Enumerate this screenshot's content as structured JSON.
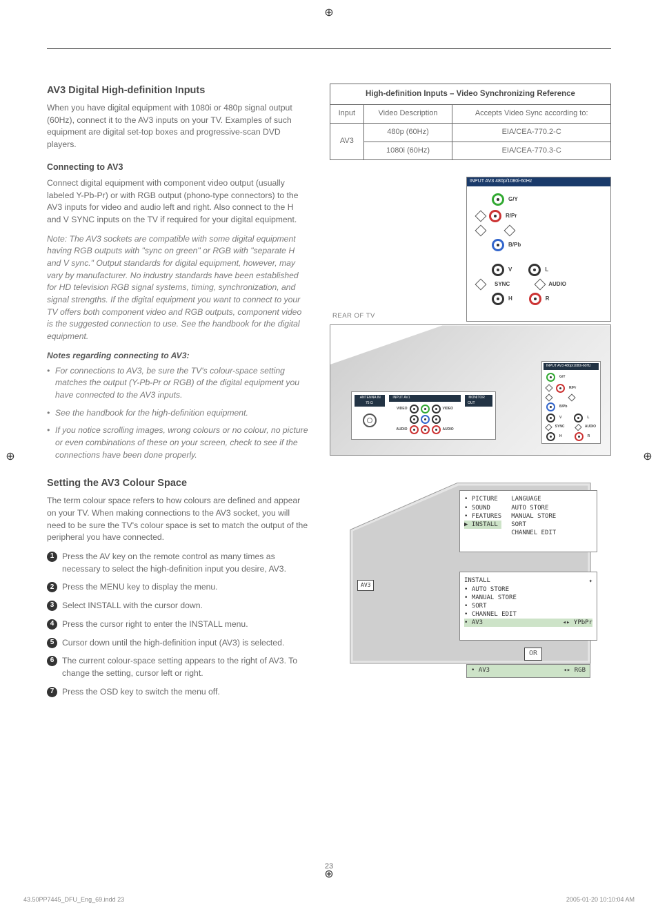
{
  "page_number": "23",
  "footer_left": "43.50PP7445_DFU_Eng_69.indd   23",
  "footer_right": "2005-01-20   10:10:04 AM",
  "section1": {
    "title": "AV3 Digital High-definition Inputs",
    "intro": "When you have digital equipment with 1080i or 480p signal output (60Hz), connect it to the AV3 inputs on your TV. Examples of such equipment are digital set-top boxes and progressive-scan DVD players.",
    "sub1": "Connecting to AV3",
    "p1": "Connect digital equipment with component video output (usually labeled Y-Pb-Pr) or with RGB output (phono-type connectors) to the AV3 inputs for video and audio left and right. Also connect to the H and V SYNC inputs on the TV if required for your digital equipment.",
    "note": "Note: The AV3 sockets are compatible with some digital equipment having RGB outputs with \"sync on green\" or RGB with \"separate H and V sync.\" Output standards for digital equipment, however, may vary by manufacturer. No industry standards have been established for HD television RGB signal systems, timing, synchronization, and signal strengths. If the digital equipment you want to connect to your TV offers both component video and RGB outputs, component video is the suggested connection to use. See the handbook for the digital equipment.",
    "notes_hdr": "Notes regarding connecting to AV3:",
    "notes": [
      "For connections to AV3, be sure the TV's colour-space setting matches the output (Y-Pb-Pr or RGB) of the digital equipment you have connected to the AV3 inputs.",
      "See the handbook for the high-definition equipment.",
      "If you notice scrolling images, wrong colours or no colour, no picture or even combinations of these on your screen, check to see if the connections have been done properly."
    ]
  },
  "section2": {
    "title": "Setting the AV3 Colour Space",
    "intro": "The term colour space refers to how colours are defined and appear on your TV. When making connections to the AV3 socket, you will need to be sure the TV's colour space is set to match the output of the peripheral you have connected.",
    "steps": [
      "Press the AV key on the remote control as many times as necessary to select the high-definition input you desire, AV3.",
      "Press the MENU key to display the menu.",
      "Select INSTALL with the cursor down.",
      "Press the cursor right to enter the INSTALL menu.",
      "Cursor down until the high-definition input (AV3) is selected.",
      "The current colour-space setting appears to the right of AV3. To change the setting, cursor left or right.",
      "Press the OSD key to switch the menu off."
    ]
  },
  "table": {
    "caption": "High-definition Inputs – Video Synchronizing Reference",
    "headers": [
      "Input",
      "Video Description",
      "Accepts Video Sync according to:"
    ],
    "rows": [
      [
        "AV3",
        "480p (60Hz)",
        "EIA/CEA-770.2-C"
      ],
      [
        "",
        "1080i (60Hz)",
        "EIA/CEA-770.3-C"
      ]
    ],
    "input_label": "AV3"
  },
  "diagrams": {
    "rear_label": "REAR OF TV",
    "top_bar": "INPUT AV3   480p/1080i-60Hz",
    "jacks": {
      "gy": "G/Y",
      "rpr": "R/Pr",
      "bpb": "B/Pb",
      "v": "V",
      "h": "H",
      "sync": "SYNC",
      "l": "L",
      "r": "R",
      "audio": "AUDIO"
    },
    "mini_bar": "INPUT AV3   480p/1080i-60Hz",
    "back_labels": {
      "ant": "ANTENNA IN 75 Ω",
      "in": "INPUT AV1",
      "mon": "MONITOR OUT",
      "video": "VIDEO",
      "audio": "AUDIO",
      "l": "L",
      "r": "R"
    }
  },
  "osd": {
    "badge": "AV3",
    "menu1_left": [
      "• PICTURE",
      "• SOUND",
      "• FEATURES",
      "▶ INSTALL"
    ],
    "menu1_right": [
      "LANGUAGE",
      "AUTO STORE",
      "MANUAL STORE",
      "SORT",
      "CHANNEL EDIT"
    ],
    "menu2_title": "INSTALL",
    "menu2_items": [
      "• AUTO STORE",
      "• MANUAL STORE",
      "• SORT",
      "• CHANNEL EDIT"
    ],
    "menu2_sel_label": "• AV3",
    "menu2_sel_val": "◂▸ YPbPr",
    "or": "OR",
    "alt_label": "• AV3",
    "alt_val": "◂▸ RGB",
    "cursor": "✦"
  }
}
